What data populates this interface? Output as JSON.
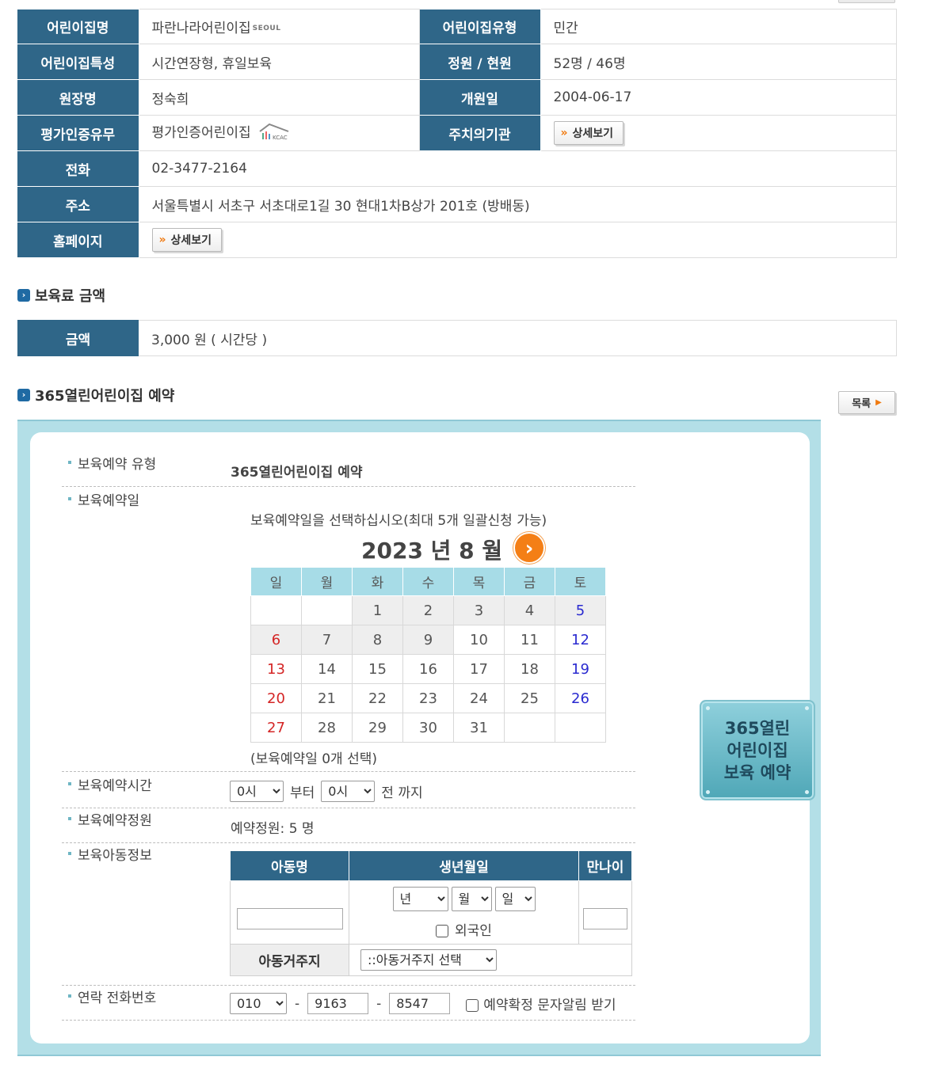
{
  "info": {
    "rows": [
      {
        "l1": "어린이집명",
        "v1": "파란나라어린이집",
        "l2": "어린이집유형",
        "v2": "민간"
      },
      {
        "l1": "어린이집특성",
        "v1": "시간연장형, 휴일보육",
        "l2": "정원 / 현원",
        "v2": "52명 / 46명"
      },
      {
        "l1": "원장명",
        "v1": "정숙희",
        "l2": "개원일",
        "v2": "2004-06-17"
      },
      {
        "l1": "평가인증유무",
        "v1": "평가인증어린이집",
        "l2": "주치의기관",
        "v2": ""
      }
    ],
    "phone_label": "전화",
    "phone": "02-3477-2164",
    "addr_label": "주소",
    "addr": "서울특별시 서초구 서초대로1길 30 현대1차B상가 201호 (방배동)",
    "home_label": "홈페이지",
    "detail_btn": "상세보기",
    "seoul_logo": "SEOUL",
    "kcac_logo": "KCAC"
  },
  "fee": {
    "section": "보육료 금액",
    "label": "금액",
    "value": "3,000 원 ( 시간당 )"
  },
  "reserve": {
    "section": "365열린어린이집 예약",
    "list_btn": "목록",
    "type_label": "보육예약 유형",
    "type_value": "365열린어린이집 예약",
    "date_label": "보육예약일",
    "date_hint": "보육예약일을 선택하십시오(최대 5개 일괄신청 가능)",
    "month_title": "2023 년 8 월",
    "weekdays": [
      "일",
      "월",
      "화",
      "수",
      "목",
      "금",
      "토"
    ],
    "selected": "(보육예약일 0개 선택)",
    "time_label": "보육예약시간",
    "time_from": "0시",
    "from_word": "부터",
    "time_to": "0시",
    "to_word": "전 까지",
    "capacity_label": "보육예약정원",
    "capacity_value": "예약정원: 5 명",
    "child_label": "보육아동정보",
    "child_headers": [
      "아동명",
      "생년월일",
      "만나이"
    ],
    "year_opt": "년",
    "month_opt": "월",
    "day_opt": "일",
    "foreign": "외국인",
    "residence_label": "아동거주지",
    "residence_opt": "::아동거주지 선택",
    "contact_label": "연락 전화번호",
    "phone1": "010",
    "phone2": "9163",
    "phone3": "8547",
    "dash": "-",
    "sms": "예약확정 문자알림 받기",
    "side_btn": [
      "365열린",
      "어린이집",
      "보육 예약"
    ]
  },
  "colors": {
    "header": "#2f6688",
    "accent": "#f47f16",
    "panel": "#b3dfe7"
  }
}
